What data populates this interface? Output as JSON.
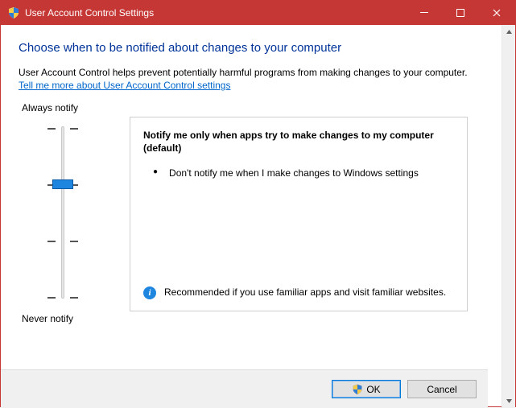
{
  "titlebar": {
    "title": "User Account Control Settings"
  },
  "page": {
    "heading": "Choose when to be notified about changes to your computer",
    "intro": "User Account Control helps prevent potentially harmful programs from making changes to your computer.",
    "help_link": "Tell me more about User Account Control settings"
  },
  "slider": {
    "top_label": "Always notify",
    "bottom_label": "Never notify",
    "levels": 4,
    "current_level": 1
  },
  "description": {
    "title": "Notify me only when apps try to make changes to my computer (default)",
    "bullet": "Don't notify me when I make changes to Windows settings",
    "recommendation": "Recommended if you use familiar apps and visit familiar websites."
  },
  "footer": {
    "ok": "OK",
    "cancel": "Cancel"
  }
}
